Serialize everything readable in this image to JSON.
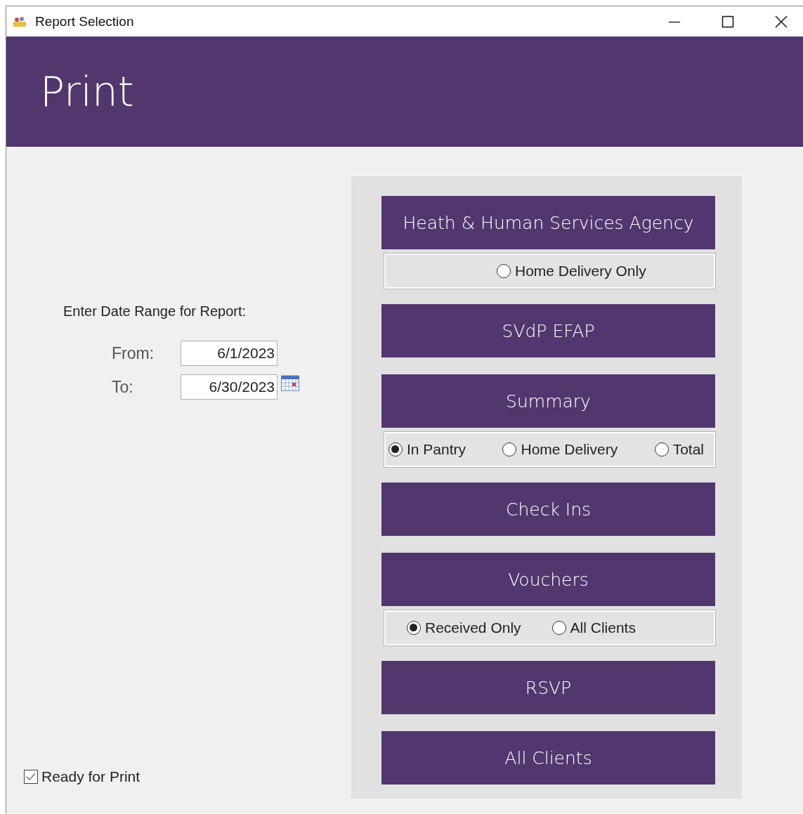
{
  "window": {
    "title": "Report Selection"
  },
  "header": {
    "title": "Print"
  },
  "date_range": {
    "label": "Enter Date Range for Report:",
    "fields": [
      {
        "label": "From:",
        "value": "6/1/2023",
        "calendar": false
      },
      {
        "label": "To:",
        "value": "6/30/2023",
        "calendar": true
      }
    ]
  },
  "ready_for_print": {
    "label": "Ready for Print",
    "checked": true
  },
  "panel": [
    {
      "kind": "button",
      "label": "Heath & Human Services Agency"
    },
    {
      "kind": "options",
      "options": [
        {
          "label": "Home Delivery Only",
          "selected": false
        }
      ]
    },
    {
      "kind": "button",
      "label": "SVdP EFAP"
    },
    {
      "kind": "button",
      "label": "Summary"
    },
    {
      "kind": "options",
      "options": [
        {
          "label": "In Pantry",
          "selected": true
        },
        {
          "label": "Home Delivery",
          "selected": false
        },
        {
          "label": "Total",
          "selected": false
        }
      ]
    },
    {
      "kind": "button",
      "label": "Check Ins"
    },
    {
      "kind": "button",
      "label": "Vouchers"
    },
    {
      "kind": "options",
      "options": [
        {
          "label": "Received Only",
          "selected": true
        },
        {
          "label": "All Clients",
          "selected": false
        }
      ]
    },
    {
      "kind": "button",
      "label": "RSVP"
    },
    {
      "kind": "button",
      "label": "All Clients"
    }
  ]
}
